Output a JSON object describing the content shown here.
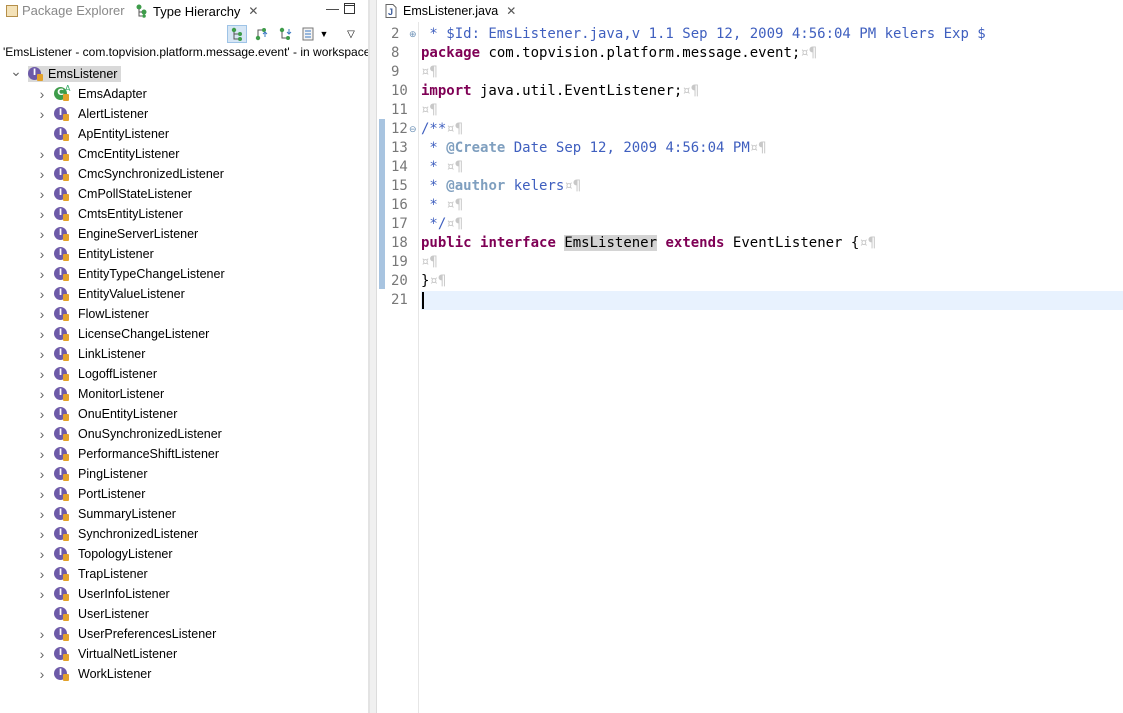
{
  "left_tabs": {
    "package_explorer": "Package Explorer",
    "type_hierarchy": "Type Hierarchy"
  },
  "hierarchy_header": "'EmsListener - com.topvision.platform.message.event' - in workspace",
  "root_type": "EmsListener",
  "subtypes": [
    {
      "name": "EmsAdapter",
      "kind": "class",
      "expandable": true
    },
    {
      "name": "AlertListener",
      "kind": "interface",
      "expandable": true
    },
    {
      "name": "ApEntityListener",
      "kind": "interface",
      "expandable": false
    },
    {
      "name": "CmcEntityListener",
      "kind": "interface",
      "expandable": true
    },
    {
      "name": "CmcSynchronizedListener",
      "kind": "interface",
      "expandable": true
    },
    {
      "name": "CmPollStateListener",
      "kind": "interface",
      "expandable": true
    },
    {
      "name": "CmtsEntityListener",
      "kind": "interface",
      "expandable": true
    },
    {
      "name": "EngineServerListener",
      "kind": "interface",
      "expandable": true
    },
    {
      "name": "EntityListener",
      "kind": "interface",
      "expandable": true
    },
    {
      "name": "EntityTypeChangeListener",
      "kind": "interface",
      "expandable": true
    },
    {
      "name": "EntityValueListener",
      "kind": "interface",
      "expandable": true
    },
    {
      "name": "FlowListener",
      "kind": "interface",
      "expandable": true
    },
    {
      "name": "LicenseChangeListener",
      "kind": "interface",
      "expandable": true
    },
    {
      "name": "LinkListener",
      "kind": "interface",
      "expandable": true
    },
    {
      "name": "LogoffListener",
      "kind": "interface",
      "expandable": true
    },
    {
      "name": "MonitorListener",
      "kind": "interface",
      "expandable": true
    },
    {
      "name": "OnuEntityListener",
      "kind": "interface",
      "expandable": true
    },
    {
      "name": "OnuSynchronizedListener",
      "kind": "interface",
      "expandable": true
    },
    {
      "name": "PerformanceShiftListener",
      "kind": "interface",
      "expandable": true
    },
    {
      "name": "PingListener",
      "kind": "interface",
      "expandable": true
    },
    {
      "name": "PortListener",
      "kind": "interface",
      "expandable": true
    },
    {
      "name": "SummaryListener",
      "kind": "interface",
      "expandable": true
    },
    {
      "name": "SynchronizedListener",
      "kind": "interface",
      "expandable": true
    },
    {
      "name": "TopologyListener",
      "kind": "interface",
      "expandable": true
    },
    {
      "name": "TrapListener",
      "kind": "interface",
      "expandable": true
    },
    {
      "name": "UserInfoListener",
      "kind": "interface",
      "expandable": true
    },
    {
      "name": "UserListener",
      "kind": "interface",
      "expandable": false
    },
    {
      "name": "UserPreferencesListener",
      "kind": "interface",
      "expandable": true
    },
    {
      "name": "VirtualNetListener",
      "kind": "interface",
      "expandable": true
    },
    {
      "name": "WorkListener",
      "kind": "interface",
      "expandable": true
    }
  ],
  "editor": {
    "tab_label": "EmsListener.java",
    "line_numbers": [
      "2",
      "8",
      "9",
      "10",
      "11",
      "12",
      "13",
      "14",
      "15",
      "16",
      "17",
      "18",
      "19",
      "20",
      "21"
    ],
    "lines": [
      [
        {
          "t": " * $Id: EmsListener.java,v 1.1 Sep 12, 2009 4:56:04 PM kelers Exp $",
          "c": "cm"
        }
      ],
      [
        {
          "t": "package",
          "c": "kw"
        },
        {
          "t": " com.topvision.platform.message.event;",
          "c": ""
        },
        {
          "t": "¤¶",
          "c": "ws"
        }
      ],
      [
        {
          "t": "¤¶",
          "c": "ws"
        }
      ],
      [
        {
          "t": "import",
          "c": "kw"
        },
        {
          "t": " java.util.EventListener;",
          "c": ""
        },
        {
          "t": "¤¶",
          "c": "ws"
        }
      ],
      [
        {
          "t": "¤¶",
          "c": "ws"
        }
      ],
      [
        {
          "t": "/**",
          "c": "cm"
        },
        {
          "t": "¤¶",
          "c": "ws"
        }
      ],
      [
        {
          "t": " * ",
          "c": "cm"
        },
        {
          "t": "@Create",
          "c": "tag"
        },
        {
          "t": " Date Sep 12, 2009 4:56:04 PM",
          "c": "cm"
        },
        {
          "t": "¤¶",
          "c": "ws"
        }
      ],
      [
        {
          "t": " * ",
          "c": "cm"
        },
        {
          "t": "¤¶",
          "c": "ws"
        }
      ],
      [
        {
          "t": " * ",
          "c": "cm"
        },
        {
          "t": "@author",
          "c": "tag"
        },
        {
          "t": " kelers",
          "c": "cm"
        },
        {
          "t": "¤¶",
          "c": "ws"
        }
      ],
      [
        {
          "t": " * ",
          "c": "cm"
        },
        {
          "t": "¤¶",
          "c": "ws"
        }
      ],
      [
        {
          "t": " */",
          "c": "cm"
        },
        {
          "t": "¤¶",
          "c": "ws"
        }
      ],
      [
        {
          "t": "public",
          "c": "kw"
        },
        {
          "t": " ",
          "c": ""
        },
        {
          "t": "interface",
          "c": "kw"
        },
        {
          "t": " ",
          "c": ""
        },
        {
          "t": "EmsListener",
          "c": "sel-word"
        },
        {
          "t": " ",
          "c": ""
        },
        {
          "t": "extends",
          "c": "kw"
        },
        {
          "t": " EventListener {",
          "c": ""
        },
        {
          "t": "¤¶",
          "c": "ws"
        }
      ],
      [
        {
          "t": "¤¶",
          "c": "ws"
        }
      ],
      [
        {
          "t": "}",
          "c": ""
        },
        {
          "t": "¤¶",
          "c": "ws"
        }
      ],
      []
    ]
  },
  "colors": {
    "keyword": "#7f0055",
    "comment": "#3f5fbf",
    "javadoc_tag": "#7f9fbf",
    "current_line": "#e8f2fe",
    "interface_icon": "#6d5aa8",
    "class_icon": "#3e9c4a"
  }
}
